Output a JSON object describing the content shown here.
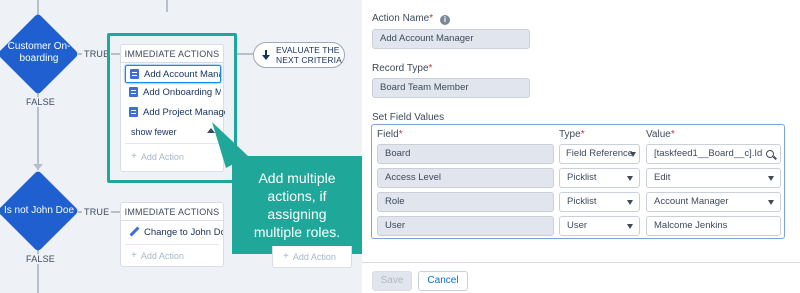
{
  "canvas": {
    "criteria1": {
      "label": "Customer On-boarding",
      "true_label": "TRUE",
      "false_label": "FALSE"
    },
    "criteria2": {
      "label": "Is not John Doe",
      "true_label": "TRUE",
      "false_label": "FALSE"
    },
    "ia1": {
      "header": "IMMEDIATE ACTIONS",
      "items": [
        "Add Account Mana...",
        "Add Onboarding M...",
        "Add Project Manager"
      ],
      "show_fewer": "show fewer",
      "add_action": "Add Action"
    },
    "ia2": {
      "header": "IMMEDIATE ACTIONS",
      "items": [
        "Change to John Doe"
      ],
      "add_action": "Add Action"
    },
    "ia3": {
      "add_action": "Add Action"
    },
    "evaluate_next": "EVALUATE THE NEXT CRITERIA",
    "callout": "Add multiple actions, if assigning multiple roles.",
    "colors": {
      "diamond": "#1f5fcf",
      "callout": "#1fa89a",
      "highlight": "#1fa89a"
    }
  },
  "form": {
    "action_name": {
      "label": "Action Name",
      "value": "Add Account Manager"
    },
    "record_type": {
      "label": "Record Type",
      "value": "Board Team Member"
    },
    "set_field_values": {
      "label": "Set Field Values",
      "columns": {
        "field": "Field",
        "type": "Type",
        "value": "Value"
      },
      "rows": [
        {
          "field": "Board",
          "type": "Field Reference",
          "value": "[taskfeed1__Board__c].Id",
          "value_icon": "search-icon"
        },
        {
          "field": "Access Level",
          "type": "Picklist",
          "value": "Edit",
          "value_icon": "caret-down-icon"
        },
        {
          "field": "Role",
          "type": "Picklist",
          "value": "Account Manager",
          "value_icon": "caret-down-icon"
        },
        {
          "field": "User",
          "type": "User",
          "value": "Malcome Jenkins",
          "value_icon": ""
        }
      ]
    },
    "buttons": {
      "save": "Save",
      "cancel": "Cancel"
    }
  }
}
